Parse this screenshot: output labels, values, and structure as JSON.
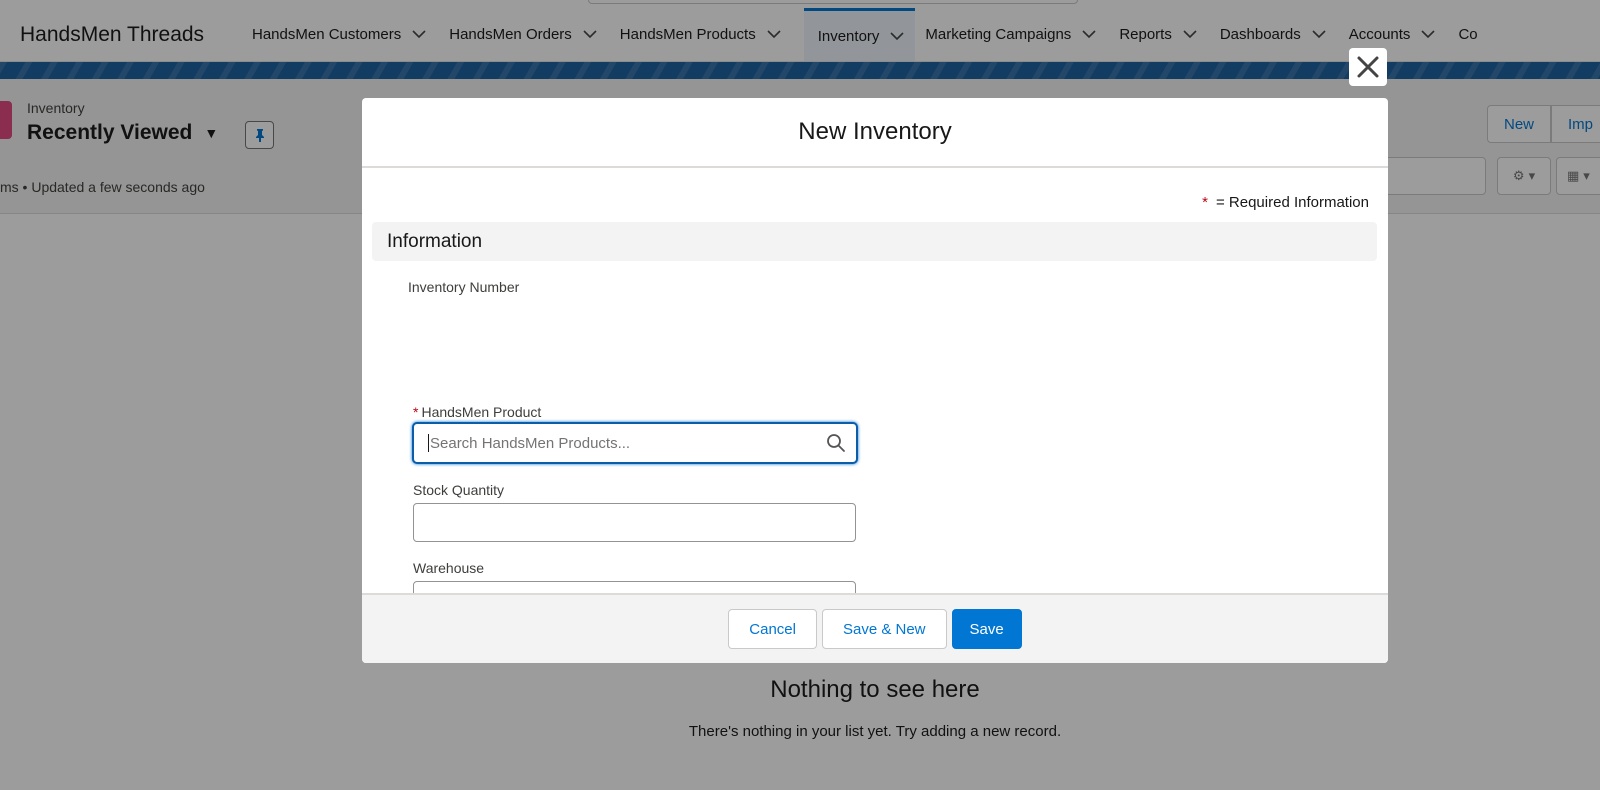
{
  "app": {
    "name": "HandsMen Threads",
    "nav": [
      {
        "label": "HandsMen Customers"
      },
      {
        "label": "HandsMen Orders"
      },
      {
        "label": "HandsMen Products"
      },
      {
        "label": "Inventory"
      },
      {
        "label": "Marketing Campaigns"
      },
      {
        "label": "Reports"
      },
      {
        "label": "Dashboards"
      },
      {
        "label": "Accounts"
      },
      {
        "label": "Co"
      }
    ],
    "active_tab": "Inventory"
  },
  "list_view": {
    "object_label": "Inventory",
    "title": "Recently Viewed",
    "meta": "ms • Updated a few seconds ago",
    "buttons": {
      "new": "New",
      "import": "Imp"
    },
    "empty_title": "Nothing to see here",
    "empty_body": "There's nothing in your list yet. Try adding a new record."
  },
  "modal": {
    "title": "New Inventory",
    "required_note": "= Required Information",
    "required_star": "*",
    "section": "Information",
    "fields": {
      "inventory_number": {
        "label": "Inventory Number"
      },
      "product": {
        "label": "HandsMen Product",
        "placeholder": "Search HandsMen Products...",
        "value": ""
      },
      "stock_quantity": {
        "label": "Stock Quantity",
        "value": ""
      },
      "warehouse": {
        "label": "Warehouse",
        "value": ""
      }
    },
    "footer": {
      "cancel": "Cancel",
      "save_new": "Save & New",
      "save": "Save"
    }
  },
  "icons": {
    "close": "close-icon",
    "search": "search-icon",
    "chevron": "chevron-down-icon",
    "pin": "pin-icon",
    "gear": "gear-icon",
    "table": "table-icon"
  },
  "colors": {
    "brand": "#0176d3",
    "required": "#ba0517",
    "object_icon": "#e3467d"
  }
}
